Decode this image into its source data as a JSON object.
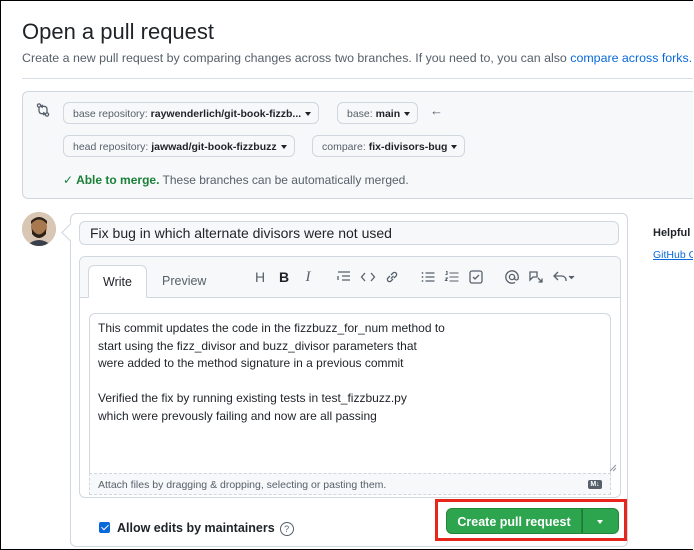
{
  "header": {
    "title": "Open a pull request",
    "subtitle": "Create a new pull request by comparing changes across two branches. If you need to, you can also ",
    "subtitle_link": "compare across forks."
  },
  "compare": {
    "base_repo_label": "base repository:",
    "base_repo_value": "raywenderlich/git-book-fizzb...",
    "base_label": "base:",
    "base_value": "main",
    "head_repo_label": "head repository:",
    "head_repo_value": "jawwad/git-book-fizzbuzz",
    "compare_label": "compare:",
    "compare_value": "fix-divisors-bug",
    "merge_status_bold": "Able to merge.",
    "merge_status_rest": " These branches can be automatically merged."
  },
  "pr": {
    "title_value": "Fix bug in which alternate divisors were not used",
    "tabs": [
      "Write",
      "Preview"
    ],
    "body": "This commit updates the code in the fizzbuzz_for_num method to\nstart using the fizz_divisor and buzz_divisor parameters that\nwere added to the method signature in a previous commit\n\nVerified the fix by running existing tests in test_fizzbuzz.py\nwhich were prevously failing and now are all passing",
    "attach_text": "Attach files by dragging & dropping, selecting or pasting them.",
    "markdown_badge": "M↓",
    "allow_edits_label": "Allow edits by maintainers",
    "help_glyph": "?",
    "create_button_label": "Create pull request"
  },
  "toolbar": {
    "heading": "H",
    "bold": "B",
    "italic": "I"
  },
  "sidebar": {
    "helpful": "Helpful r",
    "link": "GitHub C"
  },
  "colors": {
    "link": "#0969da",
    "merge_ok": "#1a7f37",
    "primary_button": "#2da44e",
    "highlight_box": "#e8251a"
  }
}
